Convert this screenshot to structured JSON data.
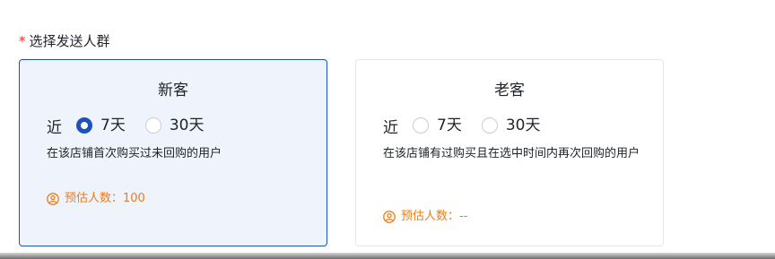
{
  "form": {
    "required_mark": "*",
    "label": "选择发送人群"
  },
  "cards": [
    {
      "title": "新客",
      "period_label": "近",
      "options": [
        {
          "label": "7天",
          "checked": true
        },
        {
          "label": "30天",
          "checked": false
        }
      ],
      "description": "在该店铺首次购买过未回购的用户",
      "estimate_label": "预估人数：",
      "estimate_value": "100",
      "selected": true
    },
    {
      "title": "老客",
      "period_label": "近",
      "options": [
        {
          "label": "7天",
          "checked": false
        },
        {
          "label": "30天",
          "checked": false
        }
      ],
      "description": "在该店铺有过购买且在选中时间内再次回购的用户",
      "estimate_label": "预估人数：",
      "estimate_value": "--",
      "selected": false
    }
  ],
  "colors": {
    "primary": "#1d52b8",
    "selected_bg": "#eef3fc",
    "estimate": "#f07b16",
    "required": "#e5322b"
  },
  "icons": {
    "estimate": "user-circle-icon"
  }
}
